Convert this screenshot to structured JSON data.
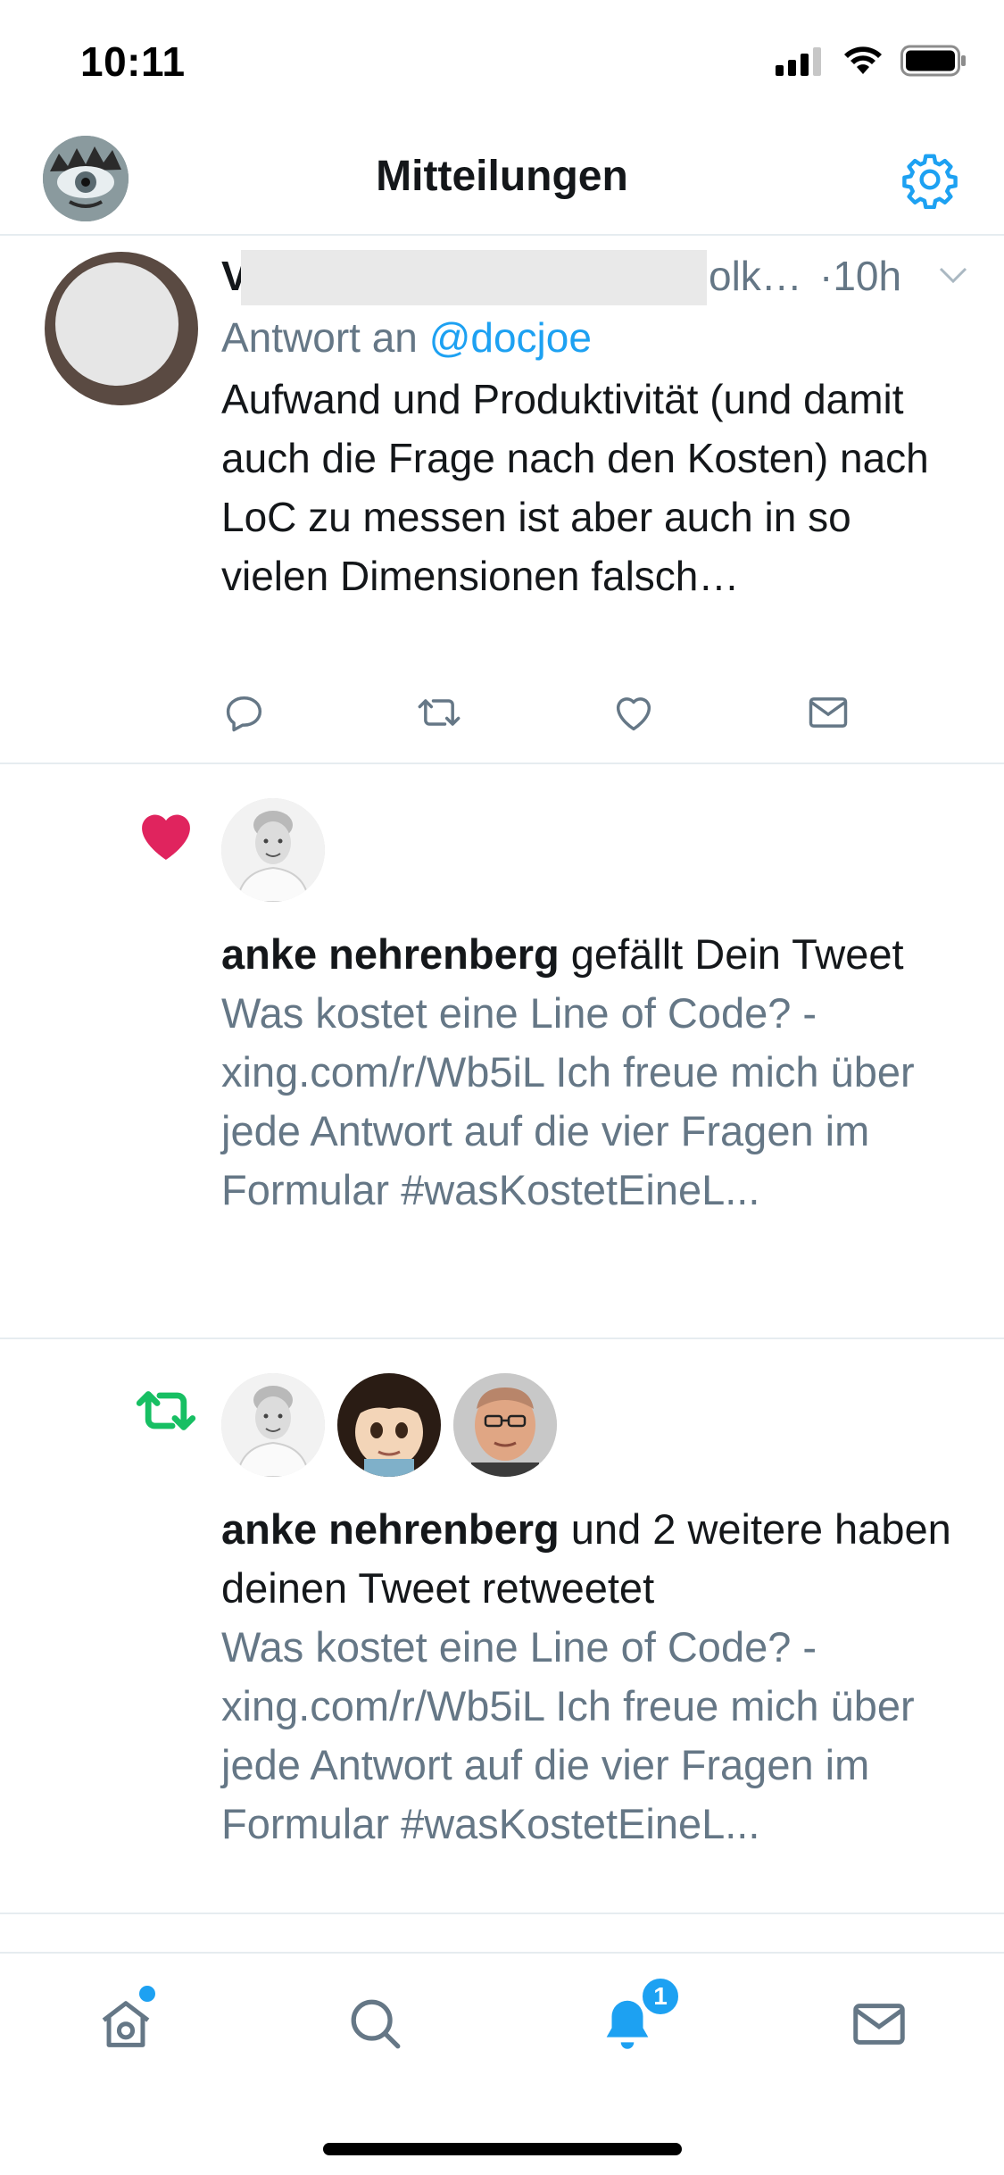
{
  "status_bar": {
    "time": "10:11"
  },
  "header": {
    "title": "Mitteilungen"
  },
  "tweet": {
    "name_first": "V",
    "name_tail": "olk…",
    "time": "·10h",
    "reply_prefix": "Antwort an ",
    "reply_mention": "@docjoe",
    "text": "Aufwand und Produktivität (und damit auch die Frage nach den Kosten) nach LoC zu messen ist aber auch in so vielen Dimensionen falsch…"
  },
  "notifications": [
    {
      "type": "like",
      "actor": "anke nehrenberg",
      "action": " gefällt Dein Tweet",
      "preview": "Was kostet eine Line of Code? - xing.com/r/Wb5iL Ich freue mich über jede Antwort auf die vier Fragen im Formular #wasKostetEineL..."
    },
    {
      "type": "retweet",
      "actor": "anke nehrenberg",
      "action": " und 2 weitere haben deinen Tweet retweetet",
      "preview": "Was kostet eine Line of Code? - xing.com/r/Wb5iL Ich freue mich über jede Antwort auf die vier Fragen im Formular #wasKostetEineL..."
    }
  ],
  "tabbar": {
    "notification_badge": "1"
  },
  "colors": {
    "accent": "#1da1f2",
    "like": "#e0245e",
    "retweet": "#17bf63",
    "secondary_text": "#657786"
  }
}
